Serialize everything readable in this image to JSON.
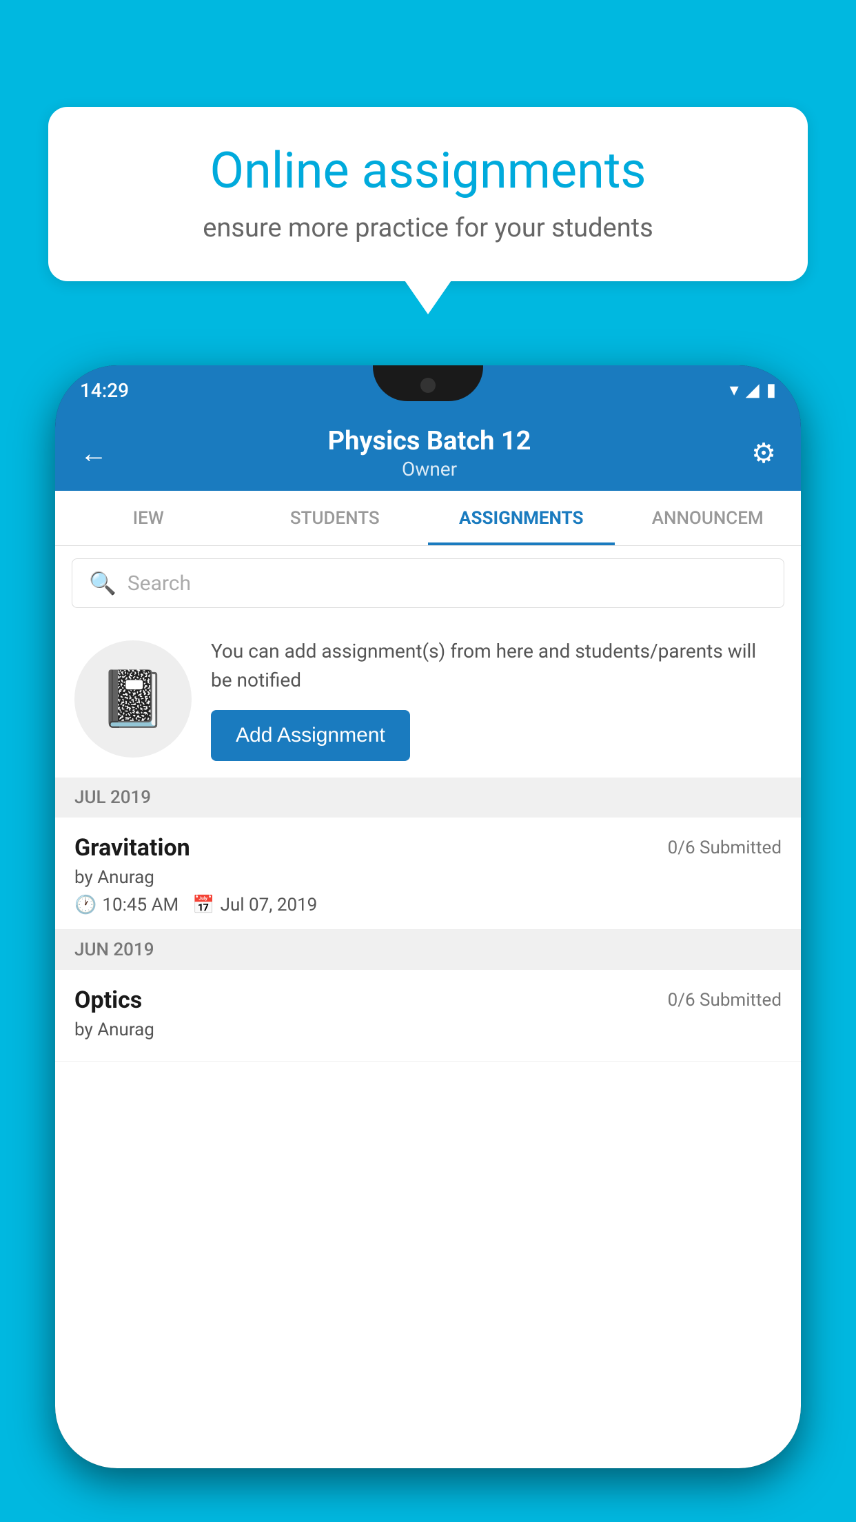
{
  "background_color": "#00b8e0",
  "bubble": {
    "title": "Online assignments",
    "subtitle": "ensure more practice for your students"
  },
  "phone": {
    "status_bar": {
      "time": "14:29",
      "icons": [
        "wifi",
        "signal",
        "battery"
      ]
    },
    "header": {
      "back_label": "←",
      "title": "Physics Batch 12",
      "subtitle": "Owner",
      "settings_label": "⚙"
    },
    "tabs": [
      {
        "label": "IEW",
        "active": false
      },
      {
        "label": "STUDENTS",
        "active": false
      },
      {
        "label": "ASSIGNMENTS",
        "active": true
      },
      {
        "label": "ANNOUNCEM",
        "active": false
      }
    ],
    "search": {
      "placeholder": "Search"
    },
    "info_card": {
      "icon": "📓",
      "description": "You can add assignment(s) from here and students/parents will be notified",
      "button_label": "Add Assignment"
    },
    "sections": [
      {
        "month_label": "JUL 2019",
        "assignments": [
          {
            "name": "Gravitation",
            "submitted": "0/6 Submitted",
            "by": "by Anurag",
            "time": "10:45 AM",
            "date": "Jul 07, 2019"
          }
        ]
      },
      {
        "month_label": "JUN 2019",
        "assignments": [
          {
            "name": "Optics",
            "submitted": "0/6 Submitted",
            "by": "by Anurag",
            "time": "",
            "date": ""
          }
        ]
      }
    ]
  }
}
